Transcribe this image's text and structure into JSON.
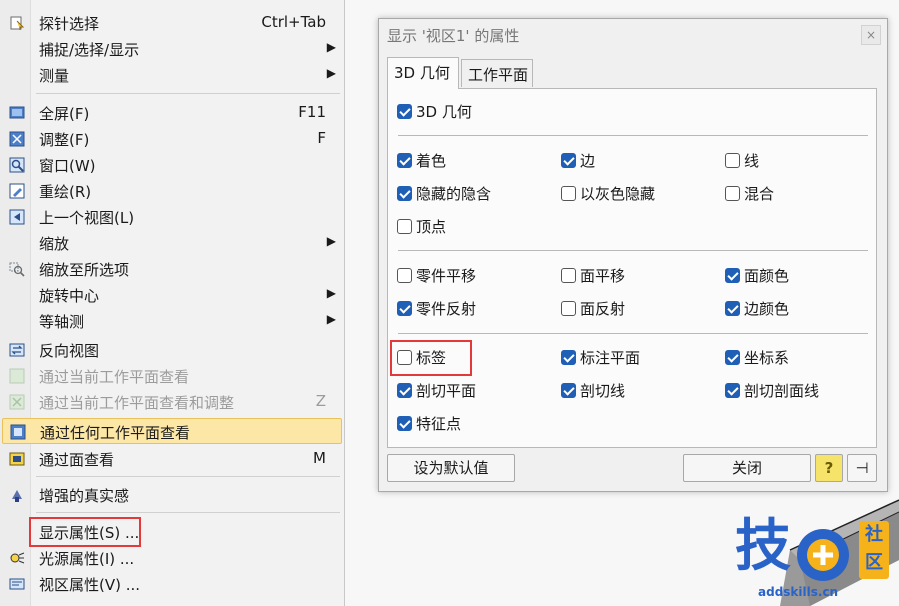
{
  "menu": {
    "items": [
      {
        "label": "探针选择",
        "shortcut": "Ctrl+Tab"
      },
      {
        "label": "捕捉/选择/显示",
        "submenu": "▶"
      },
      {
        "label": "测量",
        "submenu": "▶"
      },
      {
        "label": "全屏(F)",
        "shortcut": "F11"
      },
      {
        "label": "调整(F)",
        "shortcut": "F"
      },
      {
        "label": "窗口(W)"
      },
      {
        "label": "重绘(R)"
      },
      {
        "label": "上一个视图(L)"
      },
      {
        "label": "缩放",
        "submenu": "▶"
      },
      {
        "label": "缩放至所选项"
      },
      {
        "label": "旋转中心",
        "submenu": "▶"
      },
      {
        "label": "等轴测",
        "submenu": "▶"
      },
      {
        "label": "反向视图"
      },
      {
        "label": "通过当前工作平面查看"
      },
      {
        "label": "通过当前工作平面查看和调整",
        "shortcut": "Z"
      },
      {
        "label": "通过任何工作平面查看"
      },
      {
        "label": "通过面查看",
        "shortcut": "M"
      },
      {
        "label": "增强的真实感"
      },
      {
        "label": "显示属性(S) ..."
      },
      {
        "label": "光源属性(I) ..."
      },
      {
        "label": "视区属性(V) ..."
      }
    ]
  },
  "dialog": {
    "title": "显示 '视区1' 的属性",
    "close_glyph": "×",
    "tabs": [
      "3D 几何",
      "工作平面"
    ],
    "checkboxes": {
      "geometry_3d": {
        "label": "3D 几何",
        "checked": true
      },
      "shading": {
        "label": "着色",
        "checked": true
      },
      "edges": {
        "label": "边",
        "checked": true
      },
      "wire": {
        "label": "线",
        "checked": false
      },
      "hidden_line": {
        "label": "隐藏的隐含",
        "checked": true
      },
      "grey_hidden": {
        "label": "以灰色隐藏",
        "checked": false
      },
      "blend": {
        "label": "混合",
        "checked": false
      },
      "vertices": {
        "label": "顶点",
        "checked": false
      },
      "part_translate": {
        "label": "零件平移",
        "checked": false
      },
      "face_translate": {
        "label": "面平移",
        "checked": false
      },
      "face_color": {
        "label": "面颜色",
        "checked": true
      },
      "part_reflect": {
        "label": "零件反射",
        "checked": true
      },
      "face_reflect": {
        "label": "面反射",
        "checked": false
      },
      "edge_color": {
        "label": "边颜色",
        "checked": true
      },
      "labels": {
        "label": "标签",
        "checked": false
      },
      "dim_plane": {
        "label": "标注平面",
        "checked": true
      },
      "coord_sys": {
        "label": "坐标系",
        "checked": true
      },
      "section_plane": {
        "label": "剖切平面",
        "checked": true
      },
      "section_line": {
        "label": "剖切线",
        "checked": true
      },
      "section_hatch": {
        "label": "剖切剖面线",
        "checked": true
      },
      "feature_points": {
        "label": "特征点",
        "checked": true
      }
    },
    "buttons": {
      "set_default": "设为默认值",
      "close": "关闭",
      "help": "?",
      "pin": "⊣"
    }
  },
  "watermark": {
    "logo_text": "技",
    "side_text_1": "社",
    "side_text_2": "区",
    "url": "addskills.cn"
  },
  "colors": {
    "accent": "#1f5fb5",
    "highlight": "#fde7a6",
    "annotation": "#e23a3a"
  }
}
